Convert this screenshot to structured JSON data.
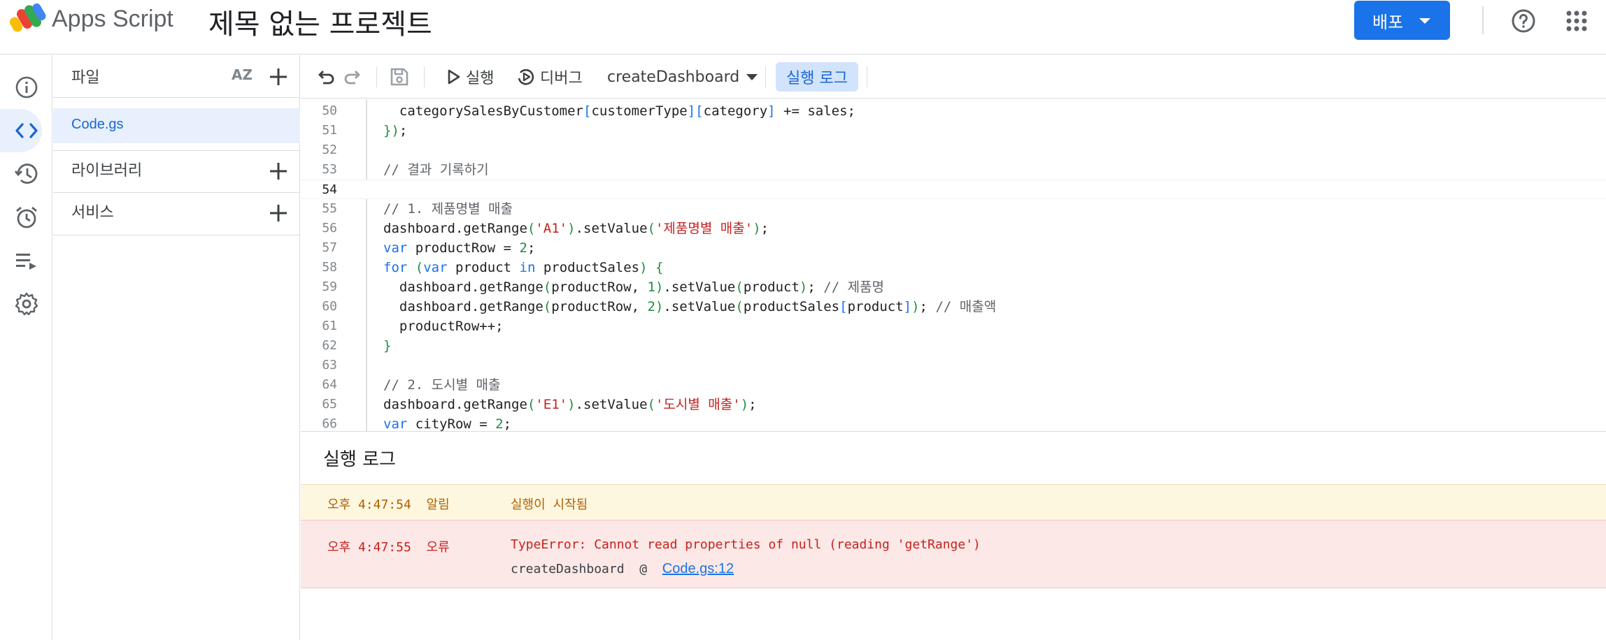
{
  "header": {
    "app_name": "Apps Script",
    "project_title": "제목 없는 프로젝트",
    "deploy_label": "배포"
  },
  "rail": {
    "items": [
      "info-icon",
      "code-icon",
      "history-icon",
      "trigger-icon",
      "executions-icon",
      "settings-icon"
    ]
  },
  "files": {
    "section_label": "파일",
    "sort_label": "AZ",
    "file_name": "Code.gs",
    "libraries_label": "라이브러리",
    "services_label": "서비스"
  },
  "toolbar": {
    "run_label": "실행",
    "debug_label": "디버그",
    "function_name": "createDashboard",
    "exec_log_label": "실행 로그"
  },
  "editor": {
    "current_line": 54,
    "lines": [
      {
        "n": "50",
        "text": "  categorySalesByCustomer[customerType][category] += sales;"
      },
      {
        "n": "51",
        "text": "});"
      },
      {
        "n": "52",
        "text": ""
      },
      {
        "n": "53",
        "text": "// 결과 기록하기"
      },
      {
        "n": "54",
        "text": ""
      },
      {
        "n": "55",
        "text": "// 1. 제품명별 매출"
      },
      {
        "n": "56",
        "text": "dashboard.getRange('A1').setValue('제품명별 매출');"
      },
      {
        "n": "57",
        "text": "var productRow = 2;"
      },
      {
        "n": "58",
        "text": "for (var product in productSales) {"
      },
      {
        "n": "59",
        "text": "  dashboard.getRange(productRow, 1).setValue(product); // 제품명"
      },
      {
        "n": "60",
        "text": "  dashboard.getRange(productRow, 2).setValue(productSales[product]); // 매출액"
      },
      {
        "n": "61",
        "text": "  productRow++;"
      },
      {
        "n": "62",
        "text": "}"
      },
      {
        "n": "63",
        "text": ""
      },
      {
        "n": "64",
        "text": "// 2. 도시별 매출"
      },
      {
        "n": "65",
        "text": "dashboard.getRange('E1').setValue('도시별 매출');"
      },
      {
        "n": "66",
        "text": "var cityRow = 2;"
      }
    ]
  },
  "log": {
    "title": "실행 로그",
    "entries": [
      {
        "time": "오후 4:47:54",
        "level": "알림",
        "message": "실행이 시작됨"
      },
      {
        "time": "오후 4:47:55",
        "level": "오류",
        "message": "TypeError: Cannot read properties of null (reading 'getRange')"
      }
    ],
    "stack_function": "createDashboard",
    "stack_at": "@",
    "stack_link": "Code.gs:12"
  },
  "colors": {
    "accent": "#1a73e8",
    "active_bg": "#e8f0fe",
    "info_bg": "#fef7e0",
    "error_bg": "#fce8e6",
    "error_text": "#c5221f"
  }
}
